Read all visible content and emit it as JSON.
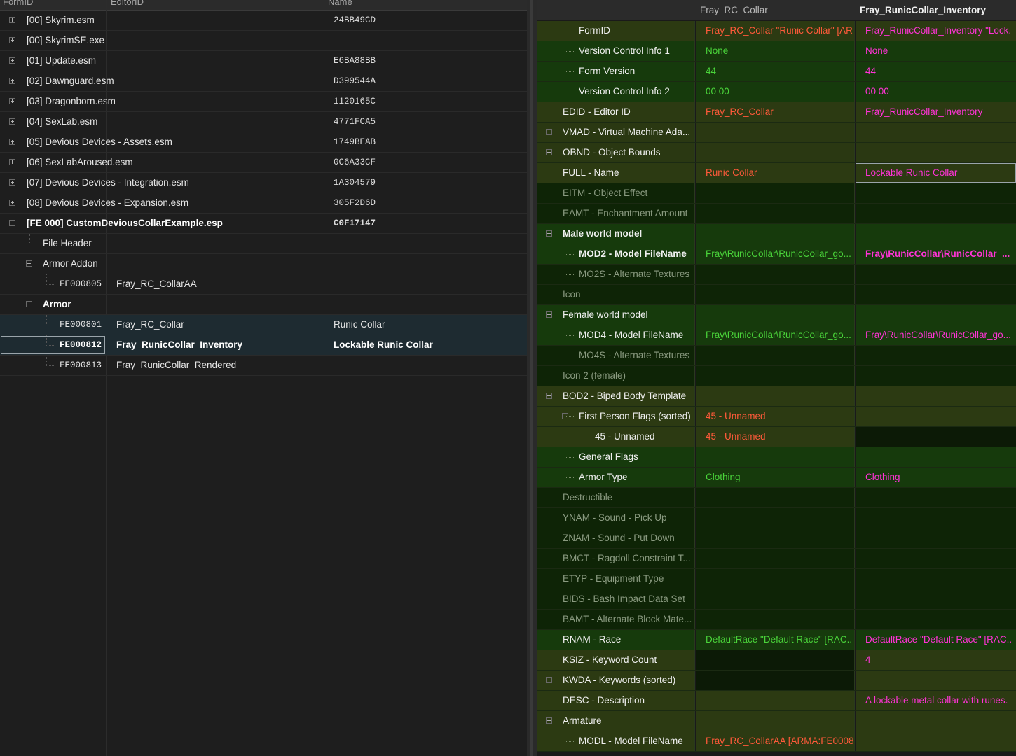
{
  "left_headers": {
    "col1": "FormID",
    "col2": "EditorID",
    "col3": "Name"
  },
  "nav_tree": {
    "plugins": [
      {
        "label": "[00] Skyrim.esm",
        "formid": "24BB49CD"
      },
      {
        "label": "[00] SkyrimSE.exe",
        "formid": ""
      },
      {
        "label": "[01] Update.esm",
        "formid": "E6BA88BB"
      },
      {
        "label": "[02] Dawnguard.esm",
        "formid": "D399544A"
      },
      {
        "label": "[03] Dragonborn.esm",
        "formid": "1120165C"
      },
      {
        "label": "[04] SexLab.esm",
        "formid": "4771FCA5"
      },
      {
        "label": "[05] Devious Devices - Assets.esm",
        "formid": "1749BEAB"
      },
      {
        "label": "[06] SexLabAroused.esm",
        "formid": "0C6A33CF"
      },
      {
        "label": "[07] Devious Devices - Integration.esm",
        "formid": "1A304579"
      },
      {
        "label": "[08] Devious Devices - Expansion.esm",
        "formid": "305F2D6D"
      }
    ],
    "active_plugin": {
      "label": "[FE 000] CustomDeviousCollarExample.esp",
      "formid": "C0F17147"
    },
    "file_header": "File Header",
    "armor_addon": "Armor Addon",
    "armor_addon_record": {
      "formid": "FE000805",
      "editorid": "Fray_RC_CollarAA"
    },
    "armor": "Armor",
    "armor_records": [
      {
        "formid": "FE000801",
        "editorid": "Fray_RC_Collar",
        "name": "Runic Collar"
      },
      {
        "formid": "FE000812",
        "editorid": "Fray_RunicCollar_Inventory",
        "name": "Lockable Runic Collar"
      },
      {
        "formid": "FE000813",
        "editorid": "Fray_RunicCollar_Rendered",
        "name": ""
      }
    ]
  },
  "compare_headers": {
    "col1": "Fray_RC_Collar",
    "col2": "Fray_RunicCollar_Inventory"
  },
  "record_view": [
    {
      "label": "FormID",
      "v1": "Fray_RC_Collar \"Runic Collar\" [AR...",
      "v2": "Fray_RunicCollar_Inventory \"Lock...",
      "indent": 1,
      "bg": "g-olive",
      "lc": "c-wht",
      "c1": "c-red",
      "c2": "c-mag"
    },
    {
      "label": "Version Control Info 1",
      "v1": "None",
      "v2": "None",
      "indent": 1,
      "bg": "g-dkgreen",
      "lc": "c-wht",
      "c1": "c-grn",
      "c2": "c-mag"
    },
    {
      "label": "Form Version",
      "v1": "44",
      "v2": "44",
      "indent": 1,
      "bg": "g-dkgreen",
      "lc": "c-wht",
      "c1": "c-grn",
      "c2": "c-mag"
    },
    {
      "label": "Version Control Info 2",
      "v1": "00 00",
      "v2": "00 00",
      "indent": 1,
      "bg": "g-dkgreen",
      "lc": "c-wht",
      "c1": "c-grn",
      "c2": "c-mag"
    },
    {
      "label": "EDID - Editor ID",
      "v1": "Fray_RC_Collar",
      "v2": "Fray_RunicCollar_Inventory",
      "indent": 0,
      "bg": "g-olive",
      "lc": "c-wht",
      "c1": "c-red",
      "c2": "c-mag"
    },
    {
      "label": "VMAD - Virtual Machine Ada...",
      "v1": "",
      "v2": "",
      "indent": 0,
      "bg": "g-olive2",
      "lc": "c-wht",
      "exp": "plus"
    },
    {
      "label": "OBND - Object Bounds",
      "v1": "",
      "v2": "",
      "indent": 0,
      "bg": "g-olive2",
      "lc": "c-wht",
      "exp": "plus"
    },
    {
      "label": "FULL - Name",
      "v1": "Runic Collar",
      "v2": "Lockable Runic Collar",
      "indent": 0,
      "bg": "g-olive",
      "lc": "c-wht",
      "c1": "c-red",
      "c2": "c-mag",
      "focus2": true
    },
    {
      "label": "EITM - Object Effect",
      "v1": "",
      "v2": "",
      "indent": 0,
      "bg": "g-darker",
      "lc": "c-gry"
    },
    {
      "label": "EAMT - Enchantment Amount",
      "v1": "",
      "v2": "",
      "indent": 0,
      "bg": "g-darker",
      "lc": "c-gry"
    },
    {
      "label": "Male world model",
      "v1": "",
      "v2": "",
      "indent": 0,
      "bg": "g-dkgreen",
      "lc": "c-wht",
      "bold": true,
      "exp": "minus"
    },
    {
      "label": "MOD2 - Model FileName",
      "v1": "Fray\\RunicCollar\\RunicCollar_go...",
      "v2": "Fray\\RunicCollar\\RunicCollar_...",
      "indent": 1,
      "bg": "g-dkgreen",
      "lc": "c-wht",
      "c1": "c-grn",
      "c2": "c-mag",
      "bold": true
    },
    {
      "label": "MO2S - Alternate Textures",
      "v1": "",
      "v2": "",
      "indent": 1,
      "bg": "g-darker",
      "lc": "c-gry"
    },
    {
      "label": "Icon",
      "v1": "",
      "v2": "",
      "indent": 0,
      "bg": "g-darker",
      "lc": "c-gry"
    },
    {
      "label": "Female world model",
      "v1": "",
      "v2": "",
      "indent": 0,
      "bg": "g-dkgreen",
      "lc": "c-wht",
      "exp": "minus"
    },
    {
      "label": "MOD4 - Model FileName",
      "v1": "Fray\\RunicCollar\\RunicCollar_go...",
      "v2": "Fray\\RunicCollar\\RunicCollar_go...",
      "indent": 1,
      "bg": "g-dkgreen",
      "lc": "c-wht",
      "c1": "c-grn",
      "c2": "c-mag"
    },
    {
      "label": "MO4S - Alternate Textures",
      "v1": "",
      "v2": "",
      "indent": 1,
      "bg": "g-darker",
      "lc": "c-gry"
    },
    {
      "label": "Icon 2 (female)",
      "v1": "",
      "v2": "",
      "indent": 0,
      "bg": "g-darker",
      "lc": "c-gry"
    },
    {
      "label": "BOD2 - Biped Body Template",
      "v1": "",
      "v2": "",
      "indent": 0,
      "bg": "g-olive",
      "lc": "c-wht",
      "exp": "minus"
    },
    {
      "label": "First Person Flags (sorted)",
      "v1": "45 - Unnamed",
      "v2": "",
      "indent": 1,
      "bg": "g-olive",
      "lc": "c-wht",
      "c1": "c-red",
      "c2": "c-mag",
      "exp": "minus"
    },
    {
      "label": "45 - Unnamed",
      "v1": "45 - Unnamed",
      "v2": "",
      "indent": 2,
      "bg": "g-olive",
      "lc": "c-wht",
      "c1": "c-red",
      "c2": "c-mag",
      "v2bg": "g-black"
    },
    {
      "label": "General Flags",
      "v1": "",
      "v2": "",
      "indent": 1,
      "bg": "g-dkgreen",
      "lc": "c-wht"
    },
    {
      "label": "Armor Type",
      "v1": "Clothing",
      "v2": "Clothing",
      "indent": 1,
      "bg": "g-dkgreen",
      "lc": "c-wht",
      "c1": "c-grn",
      "c2": "c-mag"
    },
    {
      "label": "Destructible",
      "v1": "",
      "v2": "",
      "indent": 0,
      "bg": "g-darker",
      "lc": "c-gry"
    },
    {
      "label": "YNAM - Sound - Pick Up",
      "v1": "",
      "v2": "",
      "indent": 0,
      "bg": "g-darker",
      "lc": "c-gry"
    },
    {
      "label": "ZNAM - Sound - Put Down",
      "v1": "",
      "v2": "",
      "indent": 0,
      "bg": "g-darker",
      "lc": "c-gry"
    },
    {
      "label": "BMCT - Ragdoll Constraint T...",
      "v1": "",
      "v2": "",
      "indent": 0,
      "bg": "g-darker",
      "lc": "c-gry"
    },
    {
      "label": "ETYP - Equipment Type",
      "v1": "",
      "v2": "",
      "indent": 0,
      "bg": "g-darker",
      "lc": "c-gry"
    },
    {
      "label": "BIDS - Bash Impact Data Set",
      "v1": "",
      "v2": "",
      "indent": 0,
      "bg": "g-darker",
      "lc": "c-gry"
    },
    {
      "label": "BAMT - Alternate Block Mate...",
      "v1": "",
      "v2": "",
      "indent": 0,
      "bg": "g-darker",
      "lc": "c-gry"
    },
    {
      "label": "RNAM - Race",
      "v1": "DefaultRace \"Default Race\" [RAC...",
      "v2": "DefaultRace \"Default Race\" [RAC...",
      "indent": 0,
      "bg": "g-dkgreen",
      "lc": "c-wht",
      "c1": "c-grn",
      "c2": "c-mag"
    },
    {
      "label": "KSIZ - Keyword Count",
      "v1": "",
      "v2": "4",
      "indent": 0,
      "bg": "g-olive",
      "lc": "c-wht",
      "c1": "c-red",
      "c2": "c-mag",
      "v1bg": "g-black"
    },
    {
      "label": "KWDA - Keywords (sorted)",
      "v1": "",
      "v2": "",
      "indent": 0,
      "bg": "g-olive",
      "lc": "c-wht",
      "exp": "plus",
      "v1bg": "g-black"
    },
    {
      "label": "DESC - Description",
      "v1": "",
      "v2": "A lockable metal collar with runes.",
      "indent": 0,
      "bg": "g-olive",
      "lc": "c-wht",
      "c1": "c-red",
      "c2": "c-mag"
    },
    {
      "label": "Armature",
      "v1": "",
      "v2": "",
      "indent": 0,
      "bg": "g-olive",
      "lc": "c-wht",
      "exp": "minus"
    },
    {
      "label": "MODL - Model FileName",
      "v1": "Fray_RC_CollarAA [ARMA:FE0008...",
      "v2": "",
      "indent": 1,
      "bg": "g-olive",
      "lc": "c-wht",
      "c1": "c-red",
      "c2": "c-mag"
    }
  ]
}
